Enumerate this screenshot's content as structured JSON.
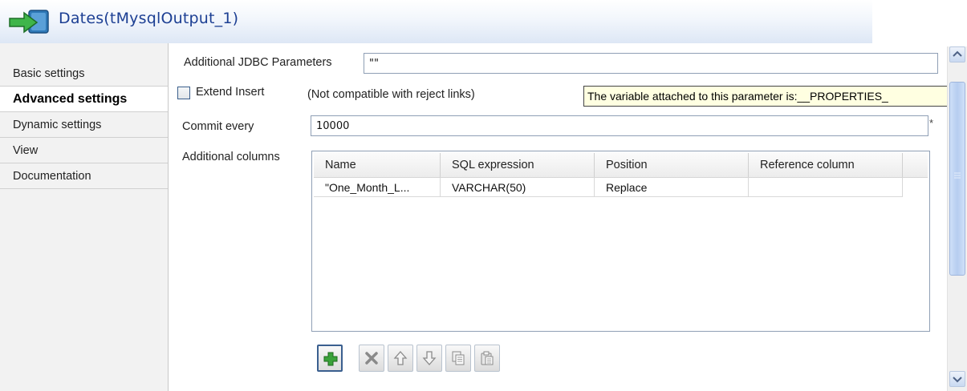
{
  "header": {
    "title": "Dates(tMysqlOutput_1)",
    "icon": "output-arrow-icon"
  },
  "sidebar": {
    "items": [
      {
        "label": "Basic settings"
      },
      {
        "label": "Advanced settings"
      },
      {
        "label": "Dynamic settings"
      },
      {
        "label": "View"
      },
      {
        "label": "Documentation"
      }
    ],
    "active_label": "Advanced settings"
  },
  "form": {
    "jdbc_label": "Additional JDBC Parameters",
    "jdbc_value": "\"\"",
    "extend_insert_label": "Extend Insert",
    "extend_insert_checked": false,
    "extend_insert_note": "(Not compatible with reject links)",
    "tooltip": "The variable attached to this parameter is:__PROPERTIES_",
    "commit_label": "Commit every",
    "commit_value": "10000",
    "required_marker": "*",
    "additional_columns_label": "Additional columns"
  },
  "table": {
    "headers": [
      "Name",
      "SQL expression",
      "Position",
      "Reference column"
    ],
    "rows": [
      [
        "\"One_Month_L...",
        "VARCHAR(50)",
        "Replace",
        ""
      ]
    ]
  },
  "toolbar": {
    "buttons": [
      "add-icon",
      "delete-icon",
      "move-up-icon",
      "move-down-icon",
      "copy-icon",
      "paste-icon"
    ]
  },
  "colors": {
    "title": "#1c3f93",
    "tooltip_bg": "#ffffe1",
    "add_green": "#3aa23a"
  }
}
